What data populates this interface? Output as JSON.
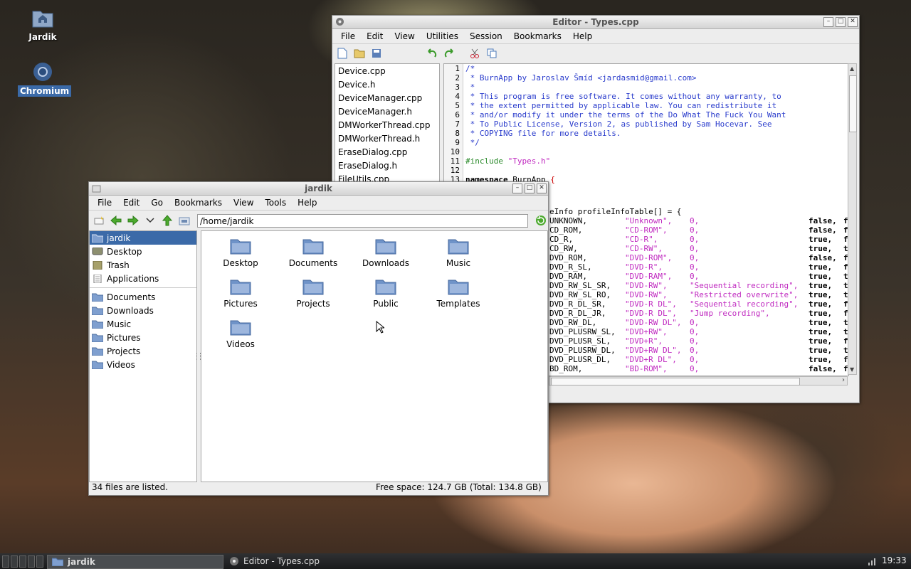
{
  "desktop": {
    "icons": [
      {
        "label": "Jardik",
        "icon": "home-folder-icon"
      },
      {
        "label": "Chromium",
        "icon": "chromium-icon"
      }
    ]
  },
  "editor": {
    "title": "Editor - Types.cpp",
    "menu": [
      "File",
      "Edit",
      "View",
      "Utilities",
      "Session",
      "Bookmarks",
      "Help"
    ],
    "files": [
      "Device.cpp",
      "Device.h",
      "DeviceManager.cpp",
      "DeviceManager.h",
      "DMWorkerThread.cpp",
      "DMWorkerThread.h",
      "EraseDialog.cpp",
      "EraseDialog.h",
      "FileUtils.cpp"
    ],
    "line_numbers": [
      "1",
      "2",
      "3",
      "4",
      "5",
      "6",
      "7",
      "8",
      "9",
      "10",
      "11",
      "12",
      "13"
    ],
    "code_lines": [
      "/*",
      " * BurnApp by Jaroslav Šmíd <jardasmid@gmail.com>",
      " *",
      " * This program is free software. It comes without any warranty, to",
      " * the extent permitted by applicable law. You can redistribute it",
      " * and/or modify it under the terms of the Do What The Fuck You Want",
      " * To Public License, Version 2, as published by Sam Hocevar. See",
      " * COPYING file for more details.",
      " */",
      "",
      "#include \"Types.h\"",
      "",
      "namespace BurnApp {"
    ],
    "table_decl": "eInfo profileInfoTable[] = {",
    "table_rows": [
      {
        "name": "UNKNOWN,",
        "str": "\"Unknown\",",
        "num": "0,",
        "desc": "",
        "b": "false,",
        "t": "f"
      },
      {
        "name": "CD_ROM,",
        "str": "\"CD-ROM\",",
        "num": "0,",
        "desc": "",
        "b": "false,",
        "t": "f"
      },
      {
        "name": "CD_R,",
        "str": "\"CD-R\",",
        "num": "0,",
        "desc": "",
        "b": "true,",
        "t": "f"
      },
      {
        "name": "CD_RW,",
        "str": "\"CD-RW\",",
        "num": "0,",
        "desc": "",
        "b": "true,",
        "t": "t"
      },
      {
        "name": "DVD_ROM,",
        "str": "\"DVD-ROM\",",
        "num": "0,",
        "desc": "",
        "b": "false,",
        "t": "f"
      },
      {
        "name": "DVD_R_SL,",
        "str": "\"DVD-R\",",
        "num": "0,",
        "desc": "",
        "b": "true,",
        "t": "f"
      },
      {
        "name": "DVD_RAM,",
        "str": "\"DVD-RAM\",",
        "num": "0,",
        "desc": "",
        "b": "true,",
        "t": "t"
      },
      {
        "name": "DVD_RW_SL_SR,",
        "str": "\"DVD-RW\",",
        "num": "",
        "desc": "\"Sequential recording\",",
        "b": "true,",
        "t": "t"
      },
      {
        "name": "DVD_RW_SL_RO,",
        "str": "\"DVD-RW\",",
        "num": "",
        "desc": "\"Restricted overwrite\",",
        "b": "true,",
        "t": "t"
      },
      {
        "name": "DVD_R_DL_SR,",
        "str": "\"DVD-R DL\",",
        "num": "",
        "desc": "\"Sequential recording\",",
        "b": "true,",
        "t": "f"
      },
      {
        "name": "DVD_R_DL_JR,",
        "str": "\"DVD-R DL\",",
        "num": "",
        "desc": "\"Jump recording\",",
        "b": "true,",
        "t": "f"
      },
      {
        "name": "DVD_RW_DL,",
        "str": "\"DVD-RW DL\",",
        "num": "0,",
        "desc": "",
        "b": "true,",
        "t": "t"
      },
      {
        "name": "DVD_PLUSRW_SL,",
        "str": "\"DVD+RW\",",
        "num": "0,",
        "desc": "",
        "b": "true,",
        "t": "t"
      },
      {
        "name": "DVD_PLUSR_SL,",
        "str": "\"DVD+R\",",
        "num": "0,",
        "desc": "",
        "b": "true,",
        "t": "f"
      },
      {
        "name": "DVD_PLUSRW_DL,",
        "str": "\"DVD+RW DL\",",
        "num": "0,",
        "desc": "",
        "b": "true,",
        "t": "t"
      },
      {
        "name": "DVD_PLUSR_DL,",
        "str": "\"DVD+R DL\",",
        "num": "0,",
        "desc": "",
        "b": "true,",
        "t": "f"
      },
      {
        "name": "BD_ROM,",
        "str": "\"BD-ROM\",",
        "num": "0,",
        "desc": "",
        "b": "false,",
        "t": "f"
      }
    ]
  },
  "filemanager": {
    "title": "jardik",
    "menu": [
      "File",
      "Edit",
      "Go",
      "Bookmarks",
      "View",
      "Tools",
      "Help"
    ],
    "path": "/home/jardik",
    "places": [
      {
        "label": "jardik",
        "icon": "home-icon",
        "selected": true
      },
      {
        "label": "Desktop",
        "icon": "desktop-icon"
      },
      {
        "label": "Trash",
        "icon": "trash-icon"
      },
      {
        "label": "Applications",
        "icon": "applications-icon"
      }
    ],
    "bookmarks": [
      "Documents",
      "Downloads",
      "Music",
      "Pictures",
      "Projects",
      "Videos"
    ],
    "folders": [
      "Desktop",
      "Documents",
      "Downloads",
      "Music",
      "Pictures",
      "Projects",
      "Public",
      "Templates",
      "Videos"
    ],
    "status_left": "34 files are listed.",
    "status_right": "Free space: 124.7 GB (Total: 134.8 GB)"
  },
  "taskbar": {
    "tasks": [
      {
        "label": "jardik",
        "icon": "folder-icon",
        "active": true
      },
      {
        "label": "Editor - Types.cpp",
        "icon": "editor-icon",
        "active": false
      }
    ],
    "clock": "19:33"
  },
  "colors": {
    "selection": "#3b6aa8",
    "comment": "#2a3ccc",
    "string": "#c02ac0",
    "folder": "#6f93c8"
  }
}
